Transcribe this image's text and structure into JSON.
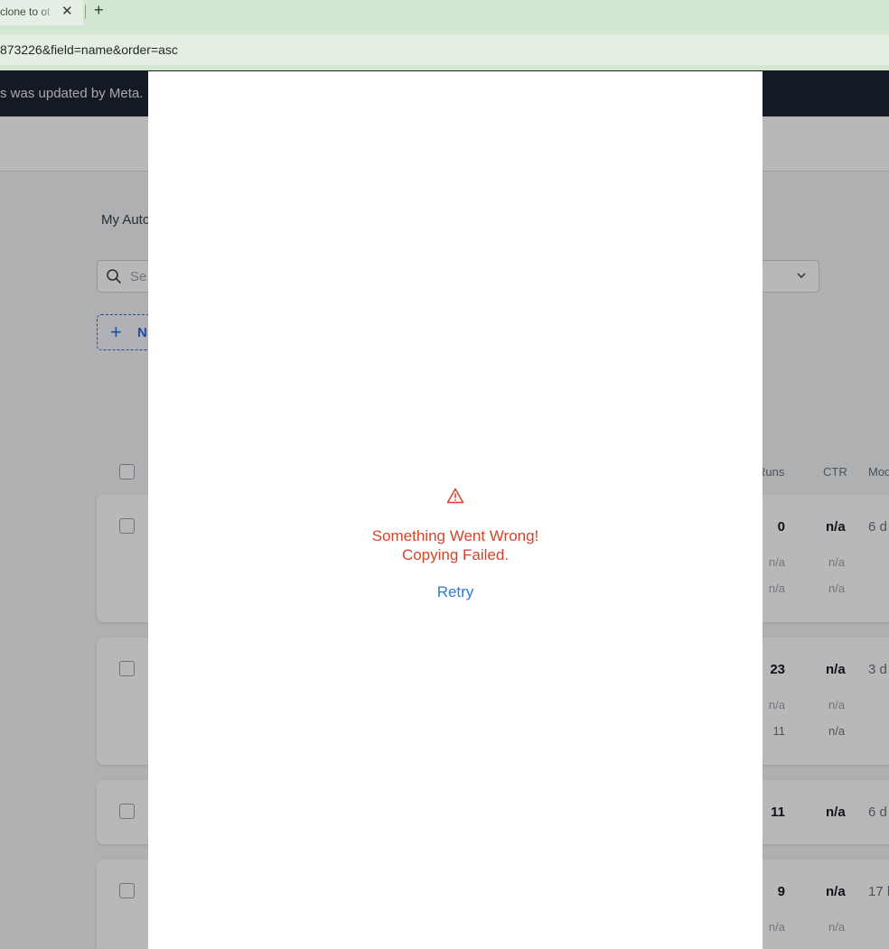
{
  "browser": {
    "tab_title": "clone to ot",
    "close_glyph": "✕",
    "new_tab_glyph": "+",
    "url": "873226&field=name&order=asc"
  },
  "app": {
    "banner_text": "s was updated by Meta.",
    "breadcrumb": "My Auto",
    "search_placeholder": "Se",
    "new_button": {
      "icon": "plus-icon",
      "label": "N"
    },
    "columns": {
      "runs": "Runs",
      "ctr": "CTR",
      "modified": "Mod"
    },
    "rows": [
      {
        "runs": "0",
        "ctr": "n/a",
        "modified": "6 d",
        "sub1_runs": "n/a",
        "sub1_ctr": "n/a",
        "sub2_runs": "n/a",
        "sub2_ctr": "n/a"
      },
      {
        "runs": "23",
        "ctr": "n/a",
        "modified": "3 d",
        "sub1_runs": "n/a",
        "sub1_ctr": "n/a",
        "sub2_runs": "11",
        "sub2_ctr": "n/a"
      },
      {
        "runs": "11",
        "ctr": "n/a",
        "modified": "6 d"
      },
      {
        "runs": "9",
        "ctr": "n/a",
        "modified": "17 h",
        "sub1_runs": "n/a",
        "sub1_ctr": "n/a"
      }
    ]
  },
  "modal": {
    "icon": "warning-icon",
    "error_line1": "Something Went Wrong!",
    "error_line2": "Copying Failed.",
    "retry_label": "Retry"
  },
  "colors": {
    "error": "#d2452a",
    "link": "#2b7ad8",
    "banner": "#1d2433",
    "browser_chrome": "#d3e6d1"
  }
}
